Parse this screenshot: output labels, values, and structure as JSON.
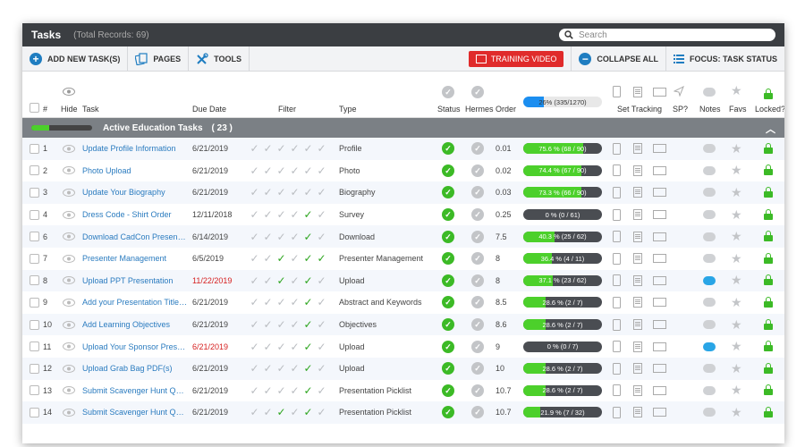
{
  "titlebar": {
    "title": "Tasks",
    "records": "(Total Records: 69)",
    "search_placeholder": "Search"
  },
  "toolbar": {
    "add_label": "ADD NEW TASK(S)",
    "pages_label": "PAGES",
    "tools_label": "TOOLS",
    "training_label": "TRAINING VIDEO",
    "collapse_label": "COLLAPSE ALL",
    "focus_label": "FOCUS: TASK STATUS"
  },
  "columns": {
    "num": "#",
    "hide": "Hide",
    "task": "Task",
    "due": "Due Date",
    "filter": "Filter",
    "type": "Type",
    "status": "Status",
    "hermes": "Hermes",
    "order": "Order",
    "overall_progress": "26% (335/1270)",
    "overall_value": 0.26,
    "set_tracking": "Set Tracking",
    "sp": "SP?",
    "notes": "Notes",
    "favs": "Favs",
    "locked": "Locked?"
  },
  "group": {
    "title": "Active Education Tasks",
    "count": "( 23 )"
  },
  "rows": [
    {
      "num": "1",
      "task": "Update Profile Information",
      "due": "6/21/2019",
      "due_red": false,
      "filter": [
        "g",
        "g",
        "g",
        "g",
        "g",
        "g"
      ],
      "type": "Profile",
      "order": "0.01",
      "progress": "75.6 % (68 / 90)",
      "pv": 0.756,
      "note": "gray"
    },
    {
      "num": "2",
      "task": "Photo Upload",
      "due": "6/21/2019",
      "due_red": false,
      "filter": [
        "g",
        "g",
        "g",
        "g",
        "g",
        "g"
      ],
      "type": "Photo",
      "order": "0.02",
      "progress": "74.4 % (67 / 90)",
      "pv": 0.744,
      "note": "gray"
    },
    {
      "num": "3",
      "task": "Update Your Biography",
      "due": "6/21/2019",
      "due_red": false,
      "filter": [
        "g",
        "g",
        "g",
        "g",
        "g",
        "g"
      ],
      "type": "Biography",
      "order": "0.03",
      "progress": "73.3 % (66 / 90)",
      "pv": 0.733,
      "note": "gray"
    },
    {
      "num": "4",
      "task": "Dress Code - Shirt Order",
      "due": "12/11/2018",
      "due_red": false,
      "filter": [
        "g",
        "g",
        "g",
        "g",
        "k",
        "g"
      ],
      "type": "Survey",
      "order": "0.25",
      "progress": "0 % (0 / 61)",
      "pv": 0,
      "note": "gray"
    },
    {
      "num": "6",
      "task": "Download CadCon Presentation",
      "due": "6/14/2019",
      "due_red": false,
      "filter": [
        "g",
        "g",
        "g",
        "g",
        "k",
        "g"
      ],
      "type": "Download",
      "order": "7.5",
      "progress": "40.3 % (25 / 62)",
      "pv": 0.403,
      "note": "gray"
    },
    {
      "num": "7",
      "task": "Presenter Management",
      "due": "6/5/2019",
      "due_red": false,
      "filter": [
        "g",
        "g",
        "k",
        "g",
        "k",
        "k"
      ],
      "type": "Presenter Management",
      "order": "8",
      "progress": "36.4 % (4 / 11)",
      "pv": 0.364,
      "note": "gray"
    },
    {
      "num": "8",
      "task": "Upload PPT Presentation",
      "due": "11/22/2019",
      "due_red": true,
      "filter": [
        "g",
        "g",
        "k",
        "g",
        "k",
        "g"
      ],
      "type": "Upload",
      "order": "8",
      "progress": "37.1 % (23 / 62)",
      "pv": 0.371,
      "note": "blue"
    },
    {
      "num": "9",
      "task": "Add your Presentation Title/Abstract",
      "due": "6/21/2019",
      "due_red": false,
      "filter": [
        "g",
        "g",
        "g",
        "g",
        "k",
        "g"
      ],
      "type": "Abstract and Keywords",
      "order": "8.5",
      "progress": "28.6 % (2 / 7)",
      "pv": 0.286,
      "note": "gray"
    },
    {
      "num": "10",
      "task": "Add Learning Objectives",
      "due": "6/21/2019",
      "due_red": false,
      "filter": [
        "g",
        "g",
        "g",
        "g",
        "k",
        "g"
      ],
      "type": "Objectives",
      "order": "8.6",
      "progress": "28.6 % (2 / 7)",
      "pv": 0.286,
      "note": "gray"
    },
    {
      "num": "11",
      "task": "Upload Your Sponsor Presentation",
      "due": "6/21/2019",
      "due_red": true,
      "filter": [
        "g",
        "g",
        "g",
        "g",
        "k",
        "g"
      ],
      "type": "Upload",
      "order": "9",
      "progress": "0 % (0 / 7)",
      "pv": 0,
      "note": "blue"
    },
    {
      "num": "12",
      "task": "Upload Grab Bag PDF(s)",
      "due": "6/21/2019",
      "due_red": false,
      "filter": [
        "g",
        "g",
        "g",
        "g",
        "k",
        "g"
      ],
      "type": "Upload",
      "order": "10",
      "progress": "28.6 % (2 / 7)",
      "pv": 0.286,
      "note": "gray"
    },
    {
      "num": "13",
      "task": "Submit Scavenger Hunt Question",
      "due": "6/21/2019",
      "due_red": false,
      "filter": [
        "g",
        "g",
        "g",
        "g",
        "k",
        "g"
      ],
      "type": "Presentation Picklist",
      "order": "10.7",
      "progress": "28.6 % (2 / 7)",
      "pv": 0.286,
      "note": "gray"
    },
    {
      "num": "14",
      "task": "Submit Scavenger Hunt Question",
      "due": "6/21/2019",
      "due_red": false,
      "filter": [
        "g",
        "g",
        "k",
        "g",
        "k",
        "g"
      ],
      "type": "Presentation Picklist",
      "order": "10.7",
      "progress": "21.9 % (7 / 32)",
      "pv": 0.219,
      "note": "gray"
    }
  ],
  "colors": {
    "accent": "#1f7dc1",
    "status_green": "#3cba26",
    "progress_green": "#4cd02b",
    "red": "#e02b2b"
  }
}
